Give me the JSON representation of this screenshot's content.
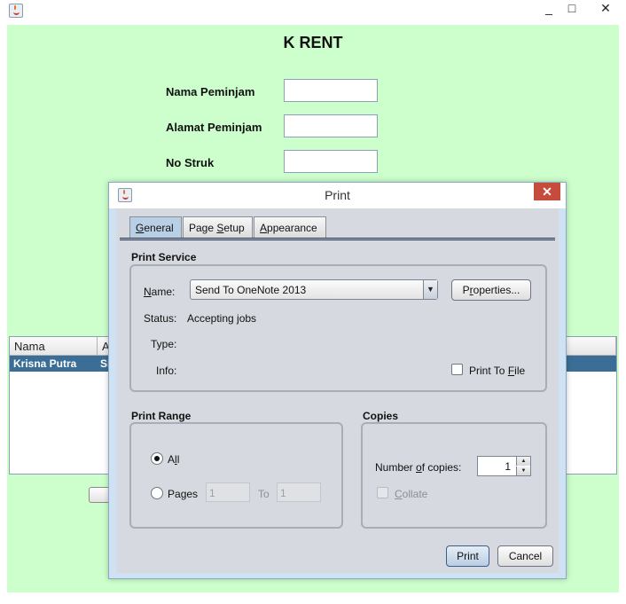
{
  "window": {
    "minimize": "_",
    "maximize": "□",
    "close": "✕"
  },
  "app": {
    "title": "K RENT",
    "fields": [
      {
        "label": "Nama Peminjam",
        "value": ""
      },
      {
        "label": "Alamat Peminjam",
        "value": ""
      },
      {
        "label": "No Struk",
        "value": ""
      }
    ],
    "table": {
      "columns": [
        "Nama",
        "A"
      ],
      "rows": [
        {
          "nama": "Krisna Putra",
          "col2": "Si"
        }
      ]
    }
  },
  "dialog": {
    "title": "Print",
    "close": "✕",
    "tabs": [
      {
        "prefix": "",
        "mnemonic": "G",
        "suffix": "eneral",
        "active": true
      },
      {
        "prefix": "Page ",
        "mnemonic": "S",
        "suffix": "etup",
        "active": false
      },
      {
        "prefix": "",
        "mnemonic": "A",
        "suffix": "ppearance",
        "active": false
      }
    ],
    "print_service": {
      "section_title": "Print Service",
      "name_label_mn": "N",
      "name_label_rest": "ame:",
      "printer_selected": "Send To OneNote 2013",
      "properties_mn_pre": "P",
      "properties_mn": "r",
      "properties_rest": "operties...",
      "status_label": "Status:",
      "status_value": "Accepting jobs",
      "type_label": "Type:",
      "info_label": "Info:",
      "print_to_file_pre": "Print To ",
      "print_to_file_mn": "F",
      "print_to_file_rest": "ile",
      "print_to_file_checked": false
    },
    "print_range": {
      "section_title": "Print Range",
      "all_pre": "A",
      "all_mn": "l",
      "all_rest": "l",
      "all_selected": true,
      "pages_pre": "Pa",
      "pages_mn": "g",
      "pages_rest": "es",
      "from_value": "1",
      "to_label": "To",
      "to_value": "1"
    },
    "copies": {
      "section_title": "Copies",
      "number_pre": "Number ",
      "number_mn": "o",
      "number_rest": "f copies:",
      "count": "1",
      "collate_mn": "C",
      "collate_rest": "ollate",
      "collate_checked": false
    },
    "buttons": {
      "print": "Print",
      "cancel": "Cancel"
    }
  }
}
